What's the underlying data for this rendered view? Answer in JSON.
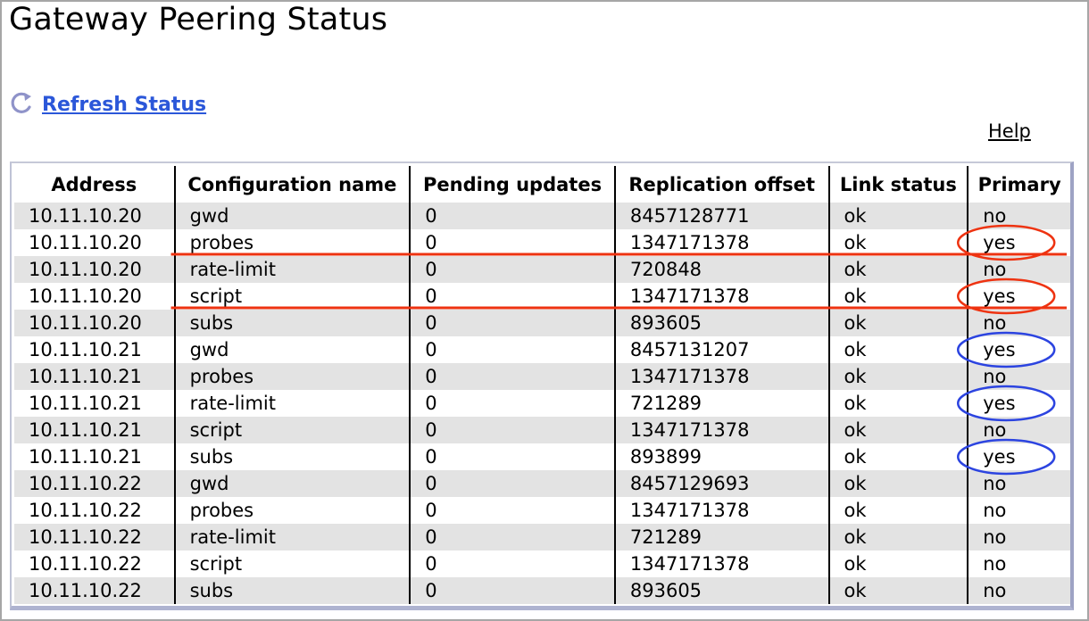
{
  "page_title": "Gateway Peering Status",
  "actions": {
    "refresh_label": "Refresh Status",
    "refresh_icon": "refresh-icon",
    "help_label": "Help"
  },
  "table": {
    "columns": [
      "Address",
      "Configuration name",
      "Pending updates",
      "Replication offset",
      "Link status",
      "Primary"
    ],
    "rows": [
      [
        "10.11.10.20",
        "gwd",
        "0",
        "8457128771",
        "ok",
        "no"
      ],
      [
        "10.11.10.20",
        "probes",
        "0",
        "1347171378",
        "ok",
        "yes"
      ],
      [
        "10.11.10.20",
        "rate-limit",
        "0",
        "720848",
        "ok",
        "no"
      ],
      [
        "10.11.10.20",
        "script",
        "0",
        "1347171378",
        "ok",
        "yes"
      ],
      [
        "10.11.10.20",
        "subs",
        "0",
        "893605",
        "ok",
        "no"
      ],
      [
        "10.11.10.21",
        "gwd",
        "0",
        "8457131207",
        "ok",
        "yes"
      ],
      [
        "10.11.10.21",
        "probes",
        "0",
        "1347171378",
        "ok",
        "no"
      ],
      [
        "10.11.10.21",
        "rate-limit",
        "0",
        "721289",
        "ok",
        "yes"
      ],
      [
        "10.11.10.21",
        "script",
        "0",
        "1347171378",
        "ok",
        "no"
      ],
      [
        "10.11.10.21",
        "subs",
        "0",
        "893899",
        "ok",
        "yes"
      ],
      [
        "10.11.10.22",
        "gwd",
        "0",
        "8457129693",
        "ok",
        "no"
      ],
      [
        "10.11.10.22",
        "probes",
        "0",
        "1347171378",
        "ok",
        "no"
      ],
      [
        "10.11.10.22",
        "rate-limit",
        "0",
        "721289",
        "ok",
        "no"
      ],
      [
        "10.11.10.22",
        "script",
        "0",
        "1347171378",
        "ok",
        "no"
      ],
      [
        "10.11.10.22",
        "subs",
        "0",
        "893605",
        "ok",
        "no"
      ]
    ]
  },
  "annotations": {
    "red_color": "#ee3311",
    "blue_color": "#2c44e0",
    "red_circled_rows": [
      1,
      3
    ],
    "red_underlined_rows": [
      1,
      3
    ],
    "blue_circled_rows": [
      5,
      7,
      9
    ]
  }
}
